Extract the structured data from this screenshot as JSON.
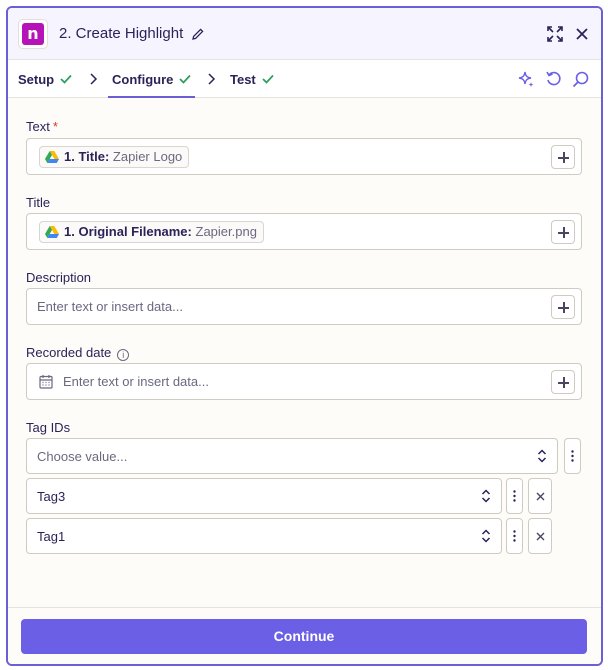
{
  "header": {
    "app_icon_letter": "n",
    "title": "2. Create Highlight",
    "brand_color": "#b512b8",
    "accent_color": "#6b5fe6"
  },
  "tabs": [
    {
      "label": "Setup",
      "status": "complete"
    },
    {
      "label": "Configure",
      "status": "complete",
      "active": true
    },
    {
      "label": "Test",
      "status": "complete"
    }
  ],
  "fields": {
    "text": {
      "label": "Text",
      "required_marker": "*",
      "pill_step": "1. Title:",
      "pill_value": "Zapier Logo"
    },
    "title": {
      "label": "Title",
      "pill_step": "1. Original Filename:",
      "pill_value": "Zapier.png"
    },
    "description": {
      "label": "Description",
      "placeholder": "Enter text or insert data..."
    },
    "recorded_date": {
      "label": "Recorded date",
      "info_glyph": "i",
      "placeholder": "Enter text or insert data..."
    },
    "tag_ids": {
      "label": "Tag IDs",
      "placeholder": "Choose value...",
      "items": [
        "Tag3",
        "Tag1"
      ]
    }
  },
  "footer": {
    "continue_label": "Continue"
  }
}
